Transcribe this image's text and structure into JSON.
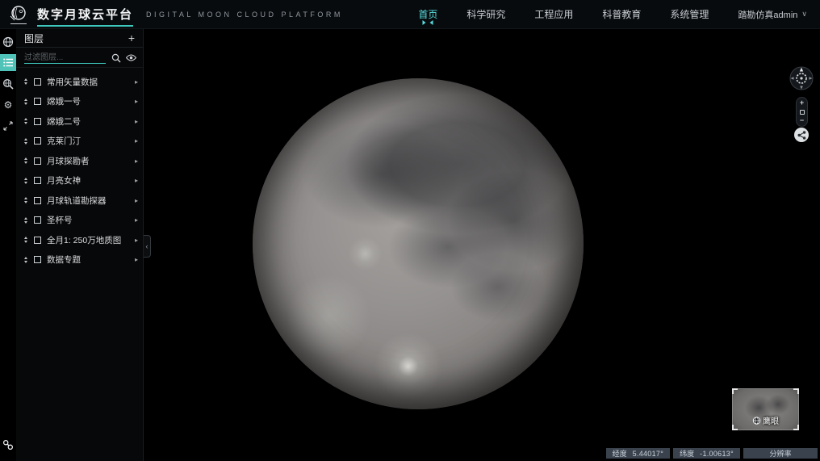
{
  "header": {
    "title": "数字月球云平台",
    "subtitle": "DIGITAL MOON CLOUD PLATFORM",
    "nav": [
      {
        "label": "首页",
        "active": true
      },
      {
        "label": "科学研究",
        "active": false
      },
      {
        "label": "工程应用",
        "active": false
      },
      {
        "label": "科普教育",
        "active": false
      },
      {
        "label": "系统管理",
        "active": false
      }
    ],
    "user": {
      "name": "踏勘仿真admin"
    }
  },
  "icon_rail": {
    "items": [
      {
        "name": "globe-icon",
        "active": false
      },
      {
        "name": "layer-list-icon",
        "active": true
      },
      {
        "name": "search-globe-icon",
        "active": false
      },
      {
        "name": "settings-icon",
        "active": false
      },
      {
        "name": "expand-icon",
        "active": false
      },
      {
        "name": "link-icon",
        "active": false
      }
    ]
  },
  "layers_panel": {
    "title": "图层",
    "filter_placeholder": "过滤图层...",
    "items": [
      {
        "label": "常用矢量数据",
        "checked": false
      },
      {
        "label": "嫦娥一号",
        "checked": false
      },
      {
        "label": "嫦娥二号",
        "checked": false
      },
      {
        "label": "克莱门汀",
        "checked": false
      },
      {
        "label": "月球探勘者",
        "checked": false
      },
      {
        "label": "月亮女神",
        "checked": false
      },
      {
        "label": "月球轨道勘探器",
        "checked": false
      },
      {
        "label": "圣杯号",
        "checked": false
      },
      {
        "label": "全月1: 250万地质图",
        "checked": false
      },
      {
        "label": "数据专题",
        "checked": false
      }
    ]
  },
  "minimap": {
    "label": "鹰眼"
  },
  "statusbar": {
    "lon_label": "经度",
    "lon_value": "5.44017°",
    "lat_label": "纬度",
    "lat_value": "-1.00613°",
    "resolution_label": "分辨率"
  },
  "icons": {
    "add": "+",
    "caret_down": "∨",
    "row_chevron": "▸",
    "collapse_chevron": "‹",
    "gear": "⚙",
    "zoom_in": "+",
    "zoom_out": "−"
  },
  "colors": {
    "accent": "#3fc8bd",
    "nav_active": "#57dfe0"
  }
}
